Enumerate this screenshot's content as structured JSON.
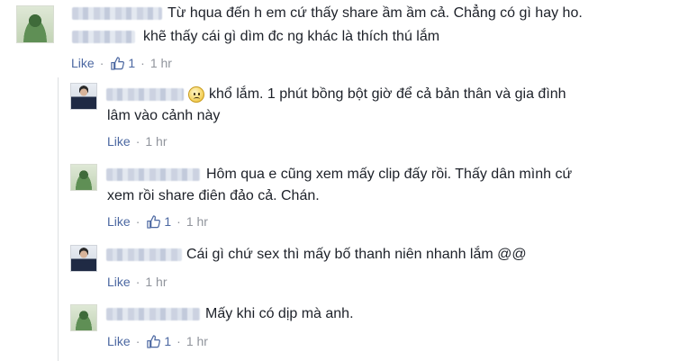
{
  "comments": [
    {
      "lines": [
        "Từ hqua đến h em cứ thấy share ầm ầm cả. Chẳng có gì hay ho.",
        "khẽ thấy cái gì dìm đc ng khác là thích thú lắm"
      ],
      "like_label": "Like",
      "like_count": "1",
      "time": "1 hr"
    },
    {
      "lines": [
        "khổ lắm. 1 phút bồng bột giờ để cả bản thân và gia đình",
        "lâm vào cảnh này"
      ],
      "like_label": "Like",
      "time": "1 hr"
    },
    {
      "lines": [
        "Hôm qua e cũng xem mấy clip đấy rồi. Thấy dân mình cứ",
        "xem rồi share điên đảo cả. Chán."
      ],
      "like_label": "Like",
      "like_count": "1",
      "time": "1 hr"
    },
    {
      "lines": [
        "Cái gì chứ sex thì mấy bố thanh niên nhanh lắm @@"
      ],
      "like_label": "Like",
      "time": "1 hr"
    },
    {
      "lines": [
        "Mấy khi có dịp mà anh."
      ],
      "like_label": "Like",
      "like_count": "1",
      "time": "1 hr"
    }
  ],
  "separator": "·"
}
